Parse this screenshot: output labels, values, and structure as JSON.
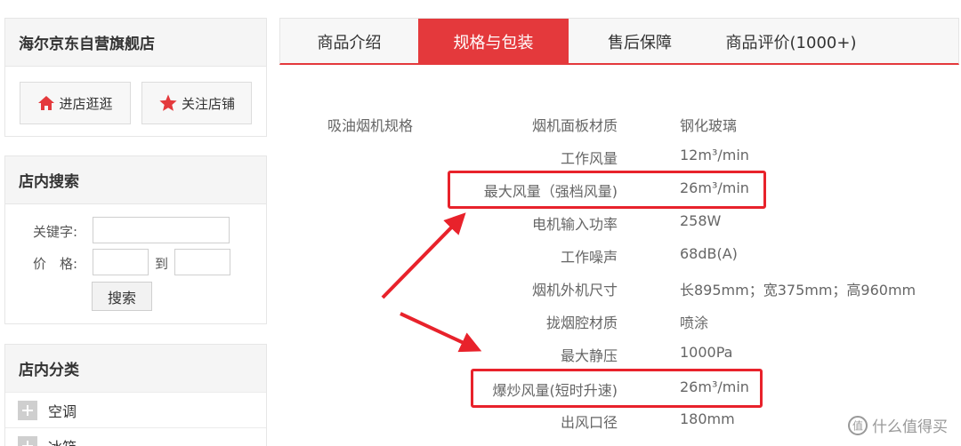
{
  "store": {
    "name": "海尔京东自营旗舰店",
    "visit_label": "进店逛逛",
    "follow_label": "关注店铺"
  },
  "search": {
    "title": "店内搜索",
    "keyword_label": "关键字:",
    "price_label": "价　格:",
    "to_label": "到",
    "button_label": "搜索",
    "keyword_value": "",
    "price_min": "",
    "price_max": ""
  },
  "categories": {
    "title": "店内分类",
    "items": [
      {
        "label": "空调"
      },
      {
        "label": "冰箱"
      }
    ]
  },
  "tabs": [
    {
      "label": "商品介绍"
    },
    {
      "label": "规格与包装",
      "active": true
    },
    {
      "label": "售后保障"
    },
    {
      "label": "商品评价(1000+)"
    }
  ],
  "spec": {
    "group": "吸油烟机规格",
    "rows": [
      {
        "name": "烟机面板材质",
        "value": "钢化玻璃"
      },
      {
        "name": "工作风量",
        "value": "12m³/min"
      },
      {
        "name": "最大风量（强档风量)",
        "value": "26m³/min"
      },
      {
        "name": "电机输入功率",
        "value": "258W"
      },
      {
        "name": "工作噪声",
        "value": "68dB(A)"
      },
      {
        "name": "烟机外机尺寸",
        "value": "长895mm；宽375mm；高960mm"
      },
      {
        "name": "拢烟腔材质",
        "value": "喷涂"
      },
      {
        "name": "最大静压",
        "value": "1000Pa"
      },
      {
        "name": "爆炒风量(短时升速)",
        "value": "26m³/min"
      },
      {
        "name": "出风口径",
        "value": "180mm"
      }
    ]
  },
  "watermark": {
    "text": "什么值得买",
    "icon": "zhide-logo-icon"
  },
  "colors": {
    "accent": "#e4393c",
    "highlight": "#e8222b"
  }
}
